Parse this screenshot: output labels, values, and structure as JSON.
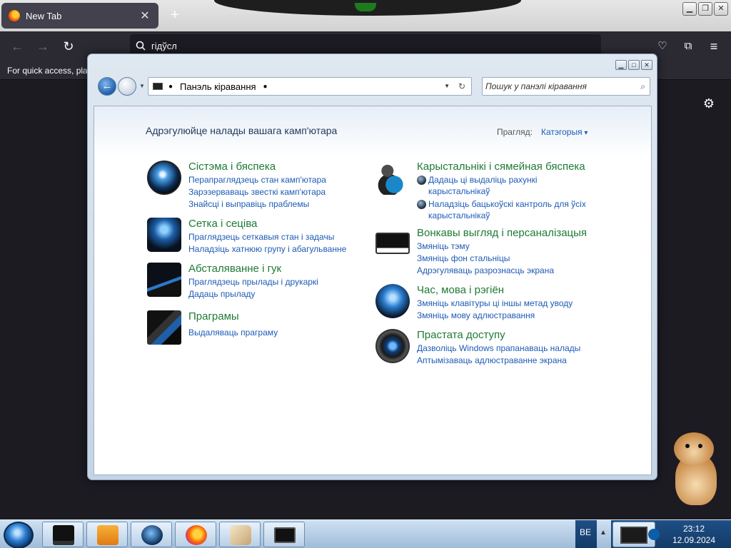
{
  "browser": {
    "tab_title": "New Tab",
    "tab_close": "✕",
    "new_tab": "+",
    "url_text": "гідўсл",
    "bookmarks_hint": "For quick access, plac"
  },
  "window": {
    "breadcrumb": "Панэль кіравання",
    "search_placeholder": "Пошук у панэлі кіравання"
  },
  "control_panel": {
    "header": "Адрэгулюйце налады вашага камп'ютара",
    "view_by_label": "Прагляд:",
    "view_by_value": "Катэгорыя",
    "left_categories": [
      {
        "title": "Сістэма і бяспека",
        "links": [
          "Перапраглядзець стан камп'ютара",
          "Зарэзерваваць звесткі камп'ютара",
          "Знайсці і выправіць праблемы"
        ]
      },
      {
        "title": "Сетка і сеціва",
        "links": [
          "Праглядзець сеткавыя стан і задачы",
          "Наладзіць хатнюю групу і абагульванне"
        ]
      },
      {
        "title": "Абсталяванне і гук",
        "links": [
          "Праглядзець прылады і друкаркі",
          "Дадаць прыладу"
        ]
      },
      {
        "title": "Праграмы",
        "links": [
          "Выдаляваць праграму"
        ]
      }
    ],
    "right_categories": [
      {
        "title": "Карыстальнікі і сямейная бяспека",
        "links": [
          "Дадаць ці выдаліць рахункі",
          "карыстальнікаў",
          "Наладзіць бацькоўскі кантроль для ўсіх",
          "карыстальнікаў"
        ]
      },
      {
        "title": "Вонкавы выгляд і персаналізацыя",
        "links": [
          "Змяніць тэму",
          "Змяніць фон стальніцы",
          "Адрэгуляваць разрознасць экрана"
        ]
      },
      {
        "title": "Час, мова і рэгіён",
        "links": [
          "Змяніць клавітуры ці іншы метад уводу",
          "Змяніць мову адлюстравання"
        ]
      },
      {
        "title": "Прастата доступу",
        "links": [
          "Дазволіць Windows прапанаваць налады",
          "Аптымізаваць адлюстраванне экрана"
        ]
      }
    ]
  },
  "taskbar": {
    "language": "BE",
    "time": "23:12",
    "date": "12.09.2024"
  },
  "colors": {
    "category_title": "#1e7a36",
    "link": "#1e5bb5",
    "browser_bg": "#1c1b22"
  }
}
